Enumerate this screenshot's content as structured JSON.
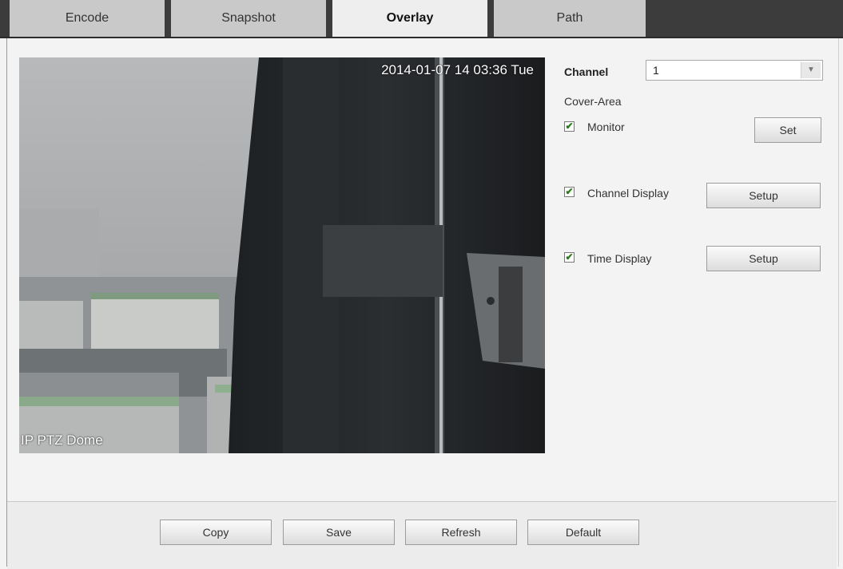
{
  "tabs": [
    {
      "label": "Encode",
      "active": false
    },
    {
      "label": "Snapshot",
      "active": false
    },
    {
      "label": "Overlay",
      "active": true
    },
    {
      "label": "Path",
      "active": false
    }
  ],
  "video": {
    "timestamp": "2014-01-07 14 03:36 Tue",
    "channel_title": "IP PTZ Dome"
  },
  "panel": {
    "channel_label": "Channel",
    "channel_value": "1",
    "cover_area_label": "Cover-Area",
    "monitor": {
      "label": "Monitor",
      "checked": true,
      "button": "Set"
    },
    "channel_display": {
      "label": "Channel Display",
      "checked": true,
      "button": "Setup"
    },
    "time_display": {
      "label": "Time Display",
      "checked": true,
      "button": "Setup"
    }
  },
  "footer": {
    "copy": "Copy",
    "save": "Save",
    "refresh": "Refresh",
    "default": "Default"
  },
  "colors": {
    "tab_bar": "#3c3c3c",
    "tab_inactive": "#c9c9c9",
    "tab_active": "#eeeeee",
    "background": "#f3f3f3",
    "checkmark": "#2a7a1a"
  }
}
